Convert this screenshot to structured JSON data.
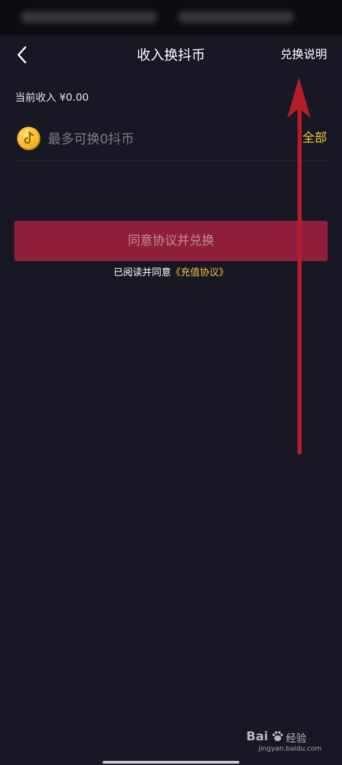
{
  "header": {
    "title": "收入换抖币",
    "help_label": "兑换说明",
    "back_icon": "chevron-left-icon"
  },
  "balance": {
    "label": "当前收入 ¥0.00"
  },
  "exchange": {
    "coin_icon": "douyin-coin-icon",
    "hint": "最多可换0抖币",
    "all_label": "全部"
  },
  "confirm": {
    "label": "同意协议并兑换"
  },
  "agreement": {
    "prefix": "已阅读并同意",
    "link": "《充值协议》"
  },
  "watermark": {
    "brand": "Bai",
    "paw_icon": "baidu-paw-icon",
    "cn": "经验",
    "site": "jingyan.baidu.com"
  },
  "colors": {
    "background": "#181825",
    "accent_gold": "#f5c13b",
    "button_red": "#8f1f3d",
    "arrow_red": "#b51d2a"
  }
}
